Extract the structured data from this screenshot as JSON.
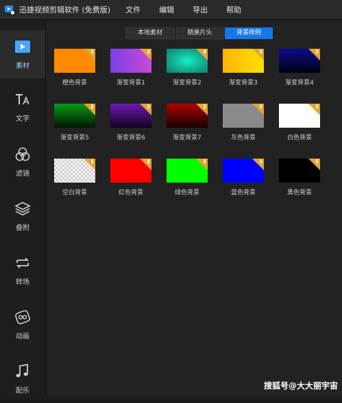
{
  "titlebar": {
    "title": "迅捷视频剪辑软件 (免费版)",
    "menu": [
      "文件",
      "编辑",
      "导出",
      "帮助"
    ]
  },
  "sidebar": {
    "items": [
      {
        "label": "素材",
        "icon": "media-icon",
        "active": true
      },
      {
        "label": "文字",
        "icon": "text-icon"
      },
      {
        "label": "滤镜",
        "icon": "filter-icon"
      },
      {
        "label": "叠附",
        "icon": "overlay-icon"
      },
      {
        "label": "转场",
        "icon": "transition-icon"
      },
      {
        "label": "动画",
        "icon": "animation-icon"
      },
      {
        "label": "配乐",
        "icon": "music-icon"
      }
    ]
  },
  "tabs": [
    {
      "label": "本地素材"
    },
    {
      "label": "精美片头"
    },
    {
      "label": "背景样例",
      "active": true
    }
  ],
  "backgrounds": [
    {
      "label": "橙色背景",
      "fill": "#ff8a00"
    },
    {
      "label": "渐变背景1",
      "fill": "linear-gradient(90deg,#7b3fe4,#c94ad8)"
    },
    {
      "label": "渐变背景2",
      "fill": "radial-gradient(ellipse at center,#17f0c0 0%,#12b89a 45%,#0d7f6c 100%)"
    },
    {
      "label": "渐变背景3",
      "fill": "linear-gradient(90deg,#ffb300,#ffe100)"
    },
    {
      "label": "渐变背景4",
      "fill": "linear-gradient(180deg,#0a0a8a,#000010)"
    },
    {
      "label": "渐变背景5",
      "fill": "linear-gradient(180deg,#0a9a1a,#001500)"
    },
    {
      "label": "渐变背景6",
      "fill": "linear-gradient(180deg,#6a1ab0,#140022)"
    },
    {
      "label": "渐变背景7",
      "fill": "linear-gradient(180deg,#b00000,#150000)"
    },
    {
      "label": "灰色背景",
      "fill": "#8a8a8a"
    },
    {
      "label": "白色背景",
      "fill": "#ffffff"
    },
    {
      "label": "空白背景",
      "fill": "checker"
    },
    {
      "label": "红色背景",
      "fill": "#ff0000"
    },
    {
      "label": "绿色背景",
      "fill": "#00ff00"
    },
    {
      "label": "蓝色背景",
      "fill": "#0000ff"
    },
    {
      "label": "黑色背景",
      "fill": "#000000"
    }
  ],
  "colors": {
    "accent": "#1677e6",
    "badge": "#e3a534",
    "icon_active": "#4aa3ff",
    "icon": "#cfcfcf"
  },
  "watermark": "搜狐号@大大丽宇宙"
}
